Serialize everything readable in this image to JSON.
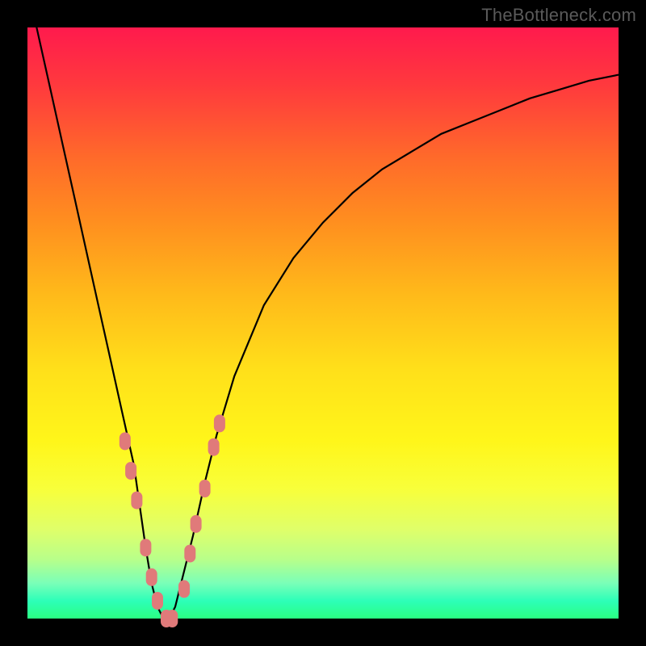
{
  "watermark": "TheBottleneck.com",
  "colors": {
    "curve": "#000000",
    "markers": "#e07a7a",
    "marker_stroke": "#c76666"
  },
  "chart_data": {
    "type": "line",
    "title": "",
    "xlabel": "",
    "ylabel": "",
    "xlim": [
      0,
      100
    ],
    "ylim": [
      0,
      100
    ],
    "x": [
      0,
      2,
      4,
      6,
      8,
      10,
      12,
      14,
      16,
      18,
      20,
      21,
      22,
      23,
      24,
      25,
      26,
      28,
      30,
      32,
      35,
      40,
      45,
      50,
      55,
      60,
      65,
      70,
      75,
      80,
      85,
      90,
      95,
      100
    ],
    "y": [
      107,
      98,
      89,
      80,
      71,
      62,
      53,
      44,
      35,
      26,
      12,
      6,
      2,
      0,
      0,
      2,
      6,
      14,
      23,
      31,
      41,
      53,
      61,
      67,
      72,
      76,
      79,
      82,
      84,
      86,
      88,
      89.5,
      91,
      92
    ],
    "marker_points": [
      {
        "x": 16.5,
        "y": 30
      },
      {
        "x": 17.5,
        "y": 25
      },
      {
        "x": 18.5,
        "y": 20
      },
      {
        "x": 20.0,
        "y": 12
      },
      {
        "x": 21.0,
        "y": 7
      },
      {
        "x": 22.0,
        "y": 3
      },
      {
        "x": 23.5,
        "y": 0
      },
      {
        "x": 24.5,
        "y": 0
      },
      {
        "x": 26.5,
        "y": 5
      },
      {
        "x": 27.5,
        "y": 11
      },
      {
        "x": 28.5,
        "y": 16
      },
      {
        "x": 30.0,
        "y": 22
      },
      {
        "x": 31.5,
        "y": 29
      },
      {
        "x": 32.5,
        "y": 33
      }
    ]
  }
}
